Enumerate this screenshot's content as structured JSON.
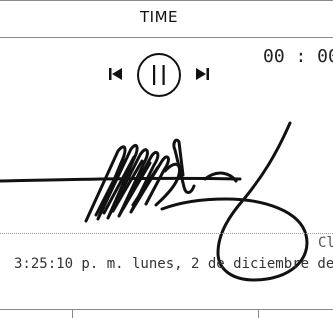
{
  "header": {
    "title": "TIME"
  },
  "timer": {
    "readout": "00 : 00"
  },
  "controls": {
    "prev_icon": "skip-previous-icon",
    "play_pause_icon": "pause-icon",
    "next_icon": "skip-next-icon"
  },
  "signature": {
    "kind": "handwritten-signature"
  },
  "caption": {
    "label": "Cl"
  },
  "footer": {
    "timestamp": "3:25:10 p. m. lunes, 2 de diciembre de"
  }
}
